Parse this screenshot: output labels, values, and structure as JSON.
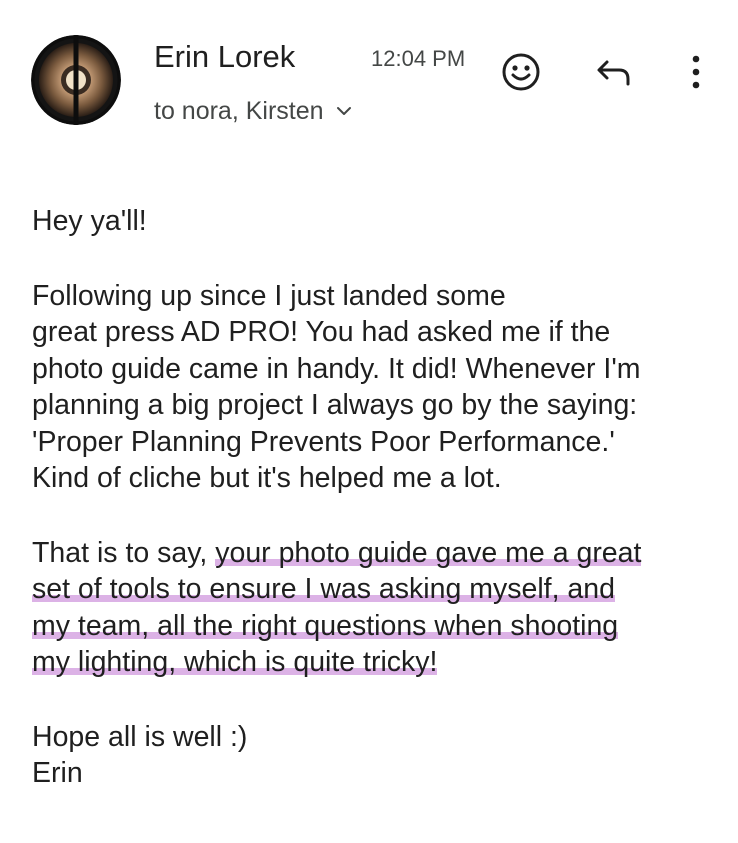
{
  "email": {
    "sender_name": "Erin Lorek",
    "time": "12:04 PM",
    "recipients": "to nora, Kirsten",
    "actions": {
      "emoji_icon": "emoji-reaction-icon",
      "reply_icon": "reply-icon",
      "more_icon": "more-vertical-icon",
      "expand_icon": "chevron-down-icon"
    },
    "body": {
      "greeting": "Hey ya'll!",
      "p1": [
        "Following up since I just landed some",
        "great press AD PRO! You had asked me if the",
        "photo guide came in handy. It did! Whenever I'm",
        "planning a big project I always go by the saying:",
        "'Proper Planning Prevents Poor Performance.'",
        "Kind of cliche but it's helped me a lot."
      ],
      "p2_lead": "That is to say, ",
      "p2_highlight": [
        "your photo guide gave me a great",
        "set of tools to ensure I was asking myself, and",
        "my team, all the right questions when shooting",
        "my lighting, which is quite tricky!"
      ],
      "closing": "Hope all is well :)",
      "signature": "Erin"
    }
  },
  "colors": {
    "text": "#1f1f1f",
    "secondary_text": "#444746",
    "highlight": "#dcb2e6",
    "background": "#ffffff"
  }
}
